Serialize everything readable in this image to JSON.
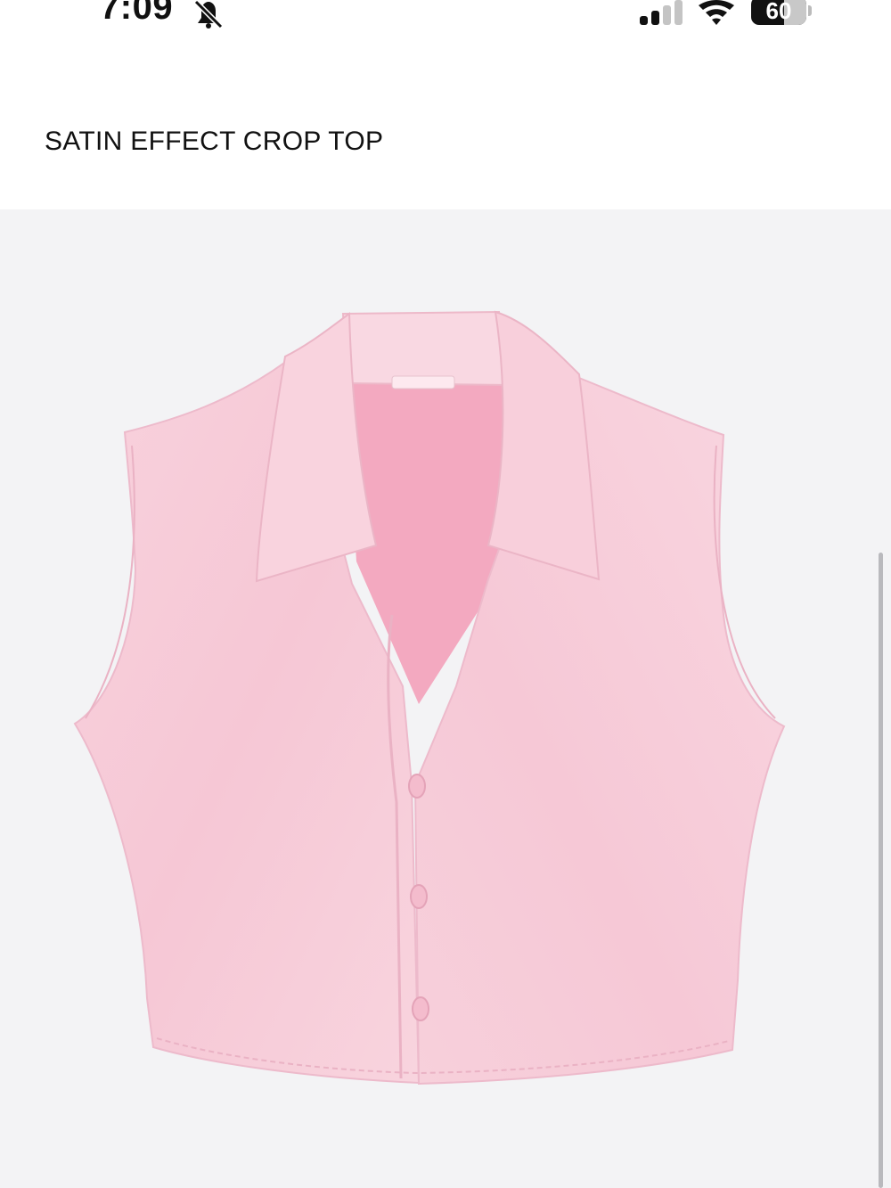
{
  "status_bar": {
    "time": "7:09",
    "bell_icon": "bell-slash-icon",
    "signal_icon": "cellular-signal-icon",
    "wifi_icon": "wifi-icon",
    "battery_level": "60",
    "battery_percent": 60
  },
  "product": {
    "title": "SATIN EFFECT CROP TOP",
    "image": {
      "subject": "pink sleeveless satin crop top with collar",
      "garment_color": "#f7cbd8",
      "inner_color": "#f2a9bf",
      "background_color": "#f3f3f5"
    }
  }
}
